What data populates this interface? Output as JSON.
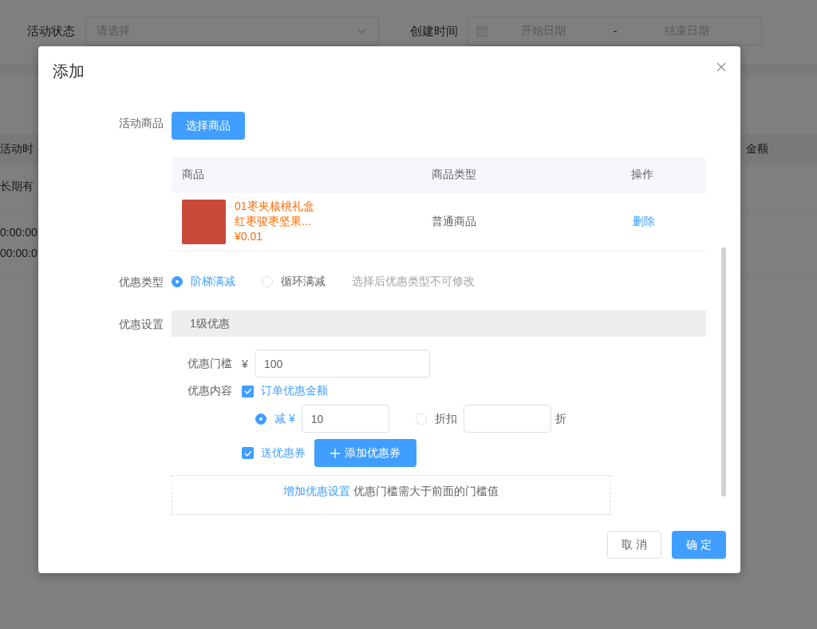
{
  "filter_bar": {
    "status_label": "活动状态",
    "status_select": {
      "placeholder": "请选择"
    },
    "created_label": "创建时间",
    "date_range": {
      "start_placeholder": "开始日期",
      "separator": "-",
      "end_placeholder": "结束日期"
    }
  },
  "background_table": {
    "columns": [
      "活动时",
      "金额"
    ],
    "rows": [
      {
        "lines": [
          "长期有"
        ]
      },
      {
        "lines": [
          "0:00:00",
          "00:00:0"
        ]
      }
    ]
  },
  "dialog": {
    "title": "添加",
    "goods": {
      "label": "活动商品",
      "button": "选择商品",
      "columns": [
        "商品",
        "商品类型",
        "操作"
      ],
      "rows": [
        {
          "name": "01枣夹核桃礼盒红枣骏枣坚果...",
          "price": "¥0.01",
          "type": "普通商品",
          "action": "删除"
        }
      ]
    },
    "discount_type": {
      "label": "优惠类型",
      "options": [
        {
          "label": "阶梯满减",
          "selected": true
        },
        {
          "label": "循环满减",
          "selected": false
        }
      ],
      "hint": "选择后优惠类型不可修改"
    },
    "settings": {
      "label": "优惠设置",
      "tiers": [
        {
          "title": "1级优惠",
          "threshold_label": "优惠门槛",
          "currency": "¥",
          "threshold_value": "100",
          "content_label": "优惠内容",
          "order_discount": {
            "label": "订单优惠金额",
            "checked": true
          },
          "modes": [
            {
              "label": "减 ¥",
              "value": "10",
              "selected": true
            },
            {
              "label": "折扣",
              "suffix": "折",
              "selected": false
            }
          ],
          "coupon": {
            "label": "送优惠券",
            "checked": true,
            "button": "添加优惠券"
          }
        }
      ]
    },
    "add_tier": {
      "link": "增加优惠设置",
      "hint": "优惠门槛需大于前面的门槛值"
    },
    "footer": {
      "cancel": "取 消",
      "confirm": "确 定"
    }
  }
}
